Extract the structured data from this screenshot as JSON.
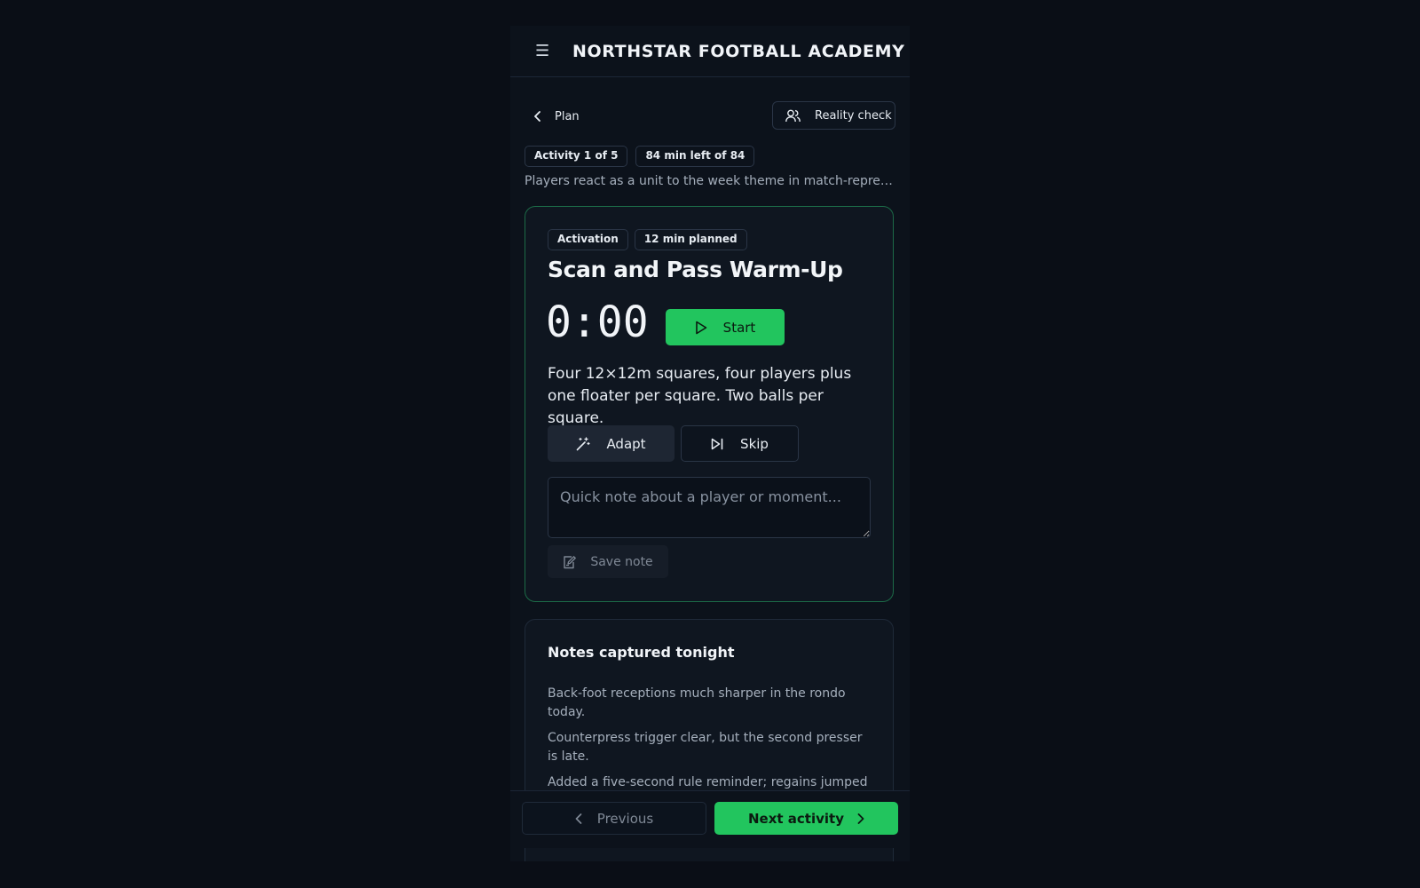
{
  "app": {
    "title": "NORTHSTAR FOOTBALL ACADEMY",
    "menu_icon": "menu-icon"
  },
  "nav": {
    "back_label": "Plan",
    "reality_check_label": "Reality check"
  },
  "session": {
    "activity_progress": "Activity 1 of 5",
    "time_left": "84 min left of 84",
    "summary": "Players react as a unit to the week theme in match-repres..."
  },
  "activity": {
    "category": "Activation",
    "planned": "12 min planned",
    "title": "Scan and Pass Warm-Up",
    "timer": "0:00",
    "start_label": "Start",
    "description": "Four 12×12m squares, four players plus one floater per square. Two balls per square.",
    "adapt_label": "Adapt",
    "skip_label": "Skip",
    "note_placeholder": "Quick note about a player or moment...",
    "save_note_label": "Save note"
  },
  "notes": {
    "title": "Notes captured tonight",
    "items": [
      "Back-foot receptions much sharper in the rondo today.",
      "Counterpress trigger clear, but the second presser is late.",
      "Added a five-second rule reminder; regains jumped once energy faded."
    ]
  },
  "footer": {
    "previous_label": "Previous",
    "next_label": "Next activity"
  },
  "colors": {
    "accent": "#22c55e",
    "background": "#0a0e16",
    "card_border_active": "#1c6a47"
  }
}
